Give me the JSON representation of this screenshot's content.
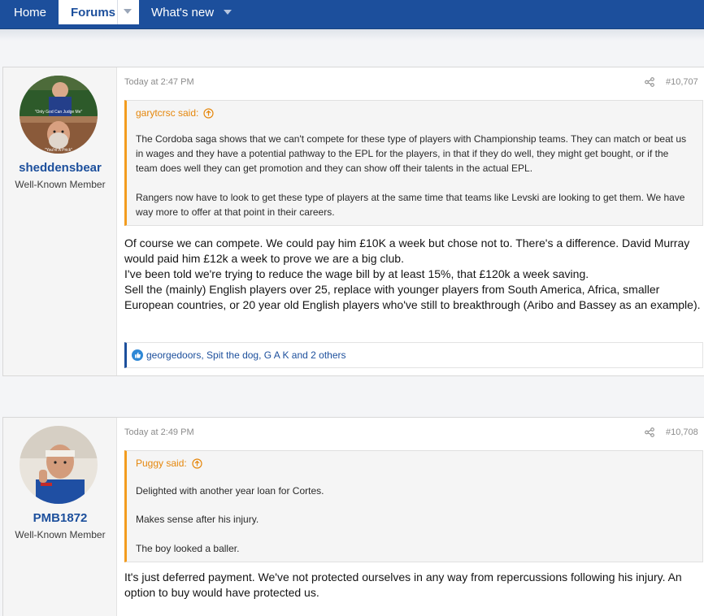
{
  "nav": {
    "home": "Home",
    "forums": "Forums",
    "whats_new": "What's new"
  },
  "posts": [
    {
      "username": "sheddensbear",
      "user_title": "Well-Known Member",
      "avatar_caption_top": "\"Only God Can Judge Me\"",
      "avatar_caption_bottom": "\"You're A Prick\"",
      "date": "Today at 2:47 PM",
      "post_number": "#10,707",
      "quote": {
        "author": "garytcrsc said:",
        "paragraphs": [
          "The Cordoba saga shows that we can't compete for these type of players with Championship teams. They can match or beat us in wages and they have a potential pathway to the EPL for the players, in that if they do well, they might get bought, or if the team does well they can get promotion and they can show off their talents in the actual EPL.",
          "Rangers now have to look to get these type of players at the same time that teams like Levski are looking to get them. We have way more to offer at that point in their careers."
        ]
      },
      "body": [
        "Of course we can compete. We could pay him £10K a week but chose not to. There's a difference. David Murray would paid him £12k a week to prove we are a big club.",
        "I've been told we're trying to reduce the wage bill by at least 15%, that £120k a week saving.",
        "Sell the (mainly) English players over 25, replace with younger players from South America, Africa, smaller European countries, or 20 year old English players who've still to breakthrough (Aribo and Bassey as an example)."
      ],
      "reactions": "georgedoors, Spit the dog, G A K and 2 others"
    },
    {
      "username": "PMB1872",
      "user_title": "Well-Known Member",
      "date": "Today at 2:49 PM",
      "post_number": "#10,708",
      "quote": {
        "author": "Puggy said:",
        "paragraphs": [
          "Delighted with another year loan for Cortes.",
          "Makes sense after his injury.",
          "The boy looked a baller."
        ]
      },
      "body": [
        "It's just deferred payment. We've not protected ourselves in any way from repercussions following his injury. An option to buy would have protected us."
      ]
    }
  ],
  "colors": {
    "nav_blue": "#1c4f9c",
    "quote_accent": "#f39c1f",
    "quote_author": "#e5870c",
    "link_blue": "#1c4f9c"
  }
}
